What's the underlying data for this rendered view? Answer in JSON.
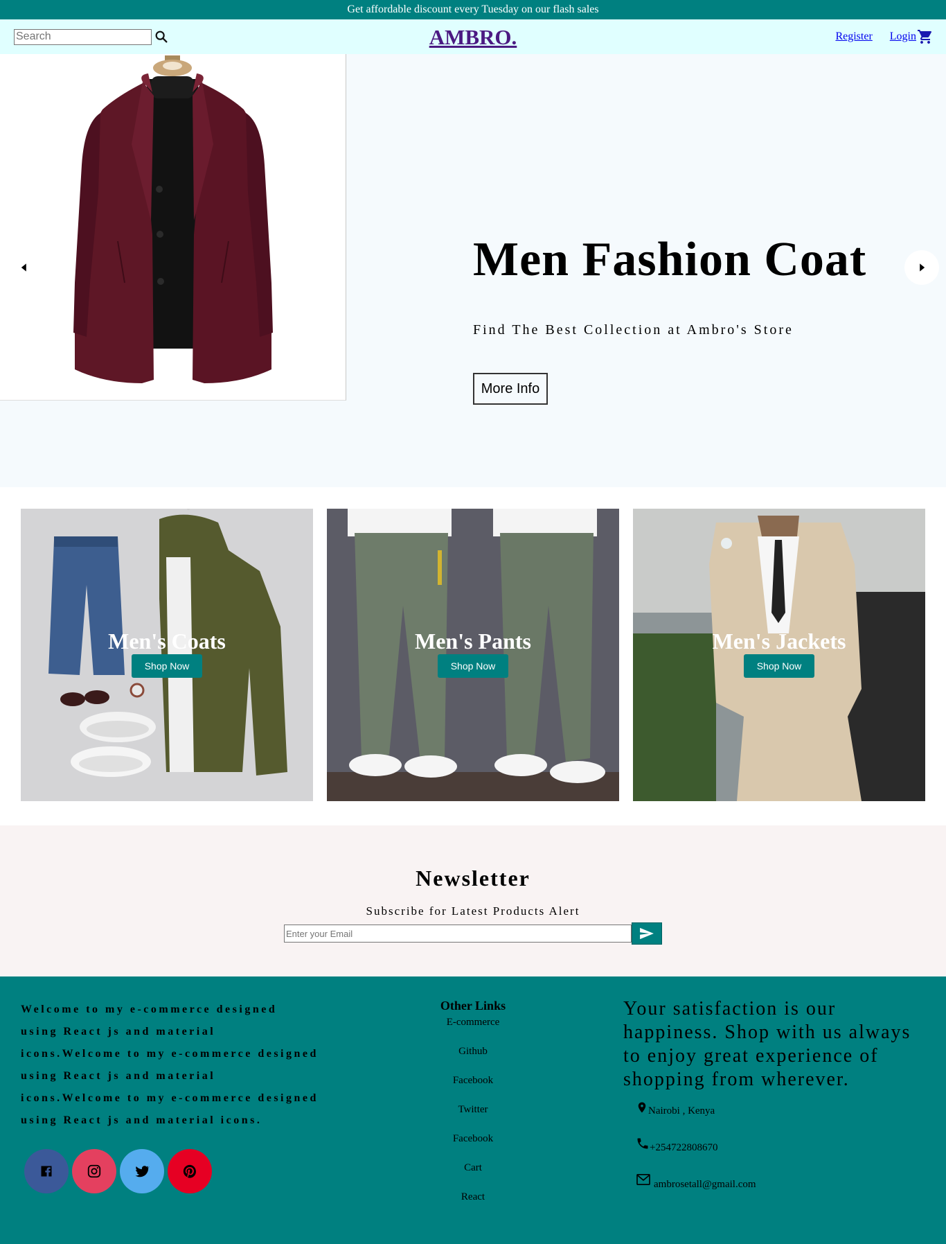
{
  "announcement": "Get affordable discount every Tuesday on our flash sales",
  "navbar": {
    "search_placeholder": "Search",
    "logo": "AMBRO.",
    "register": "Register",
    "login": "Login"
  },
  "slider": {
    "title": "Men Fashion Coat",
    "description": "Find The Best Collection at Ambro's Store",
    "button": "More Info"
  },
  "categories": [
    {
      "title": "Men's Coats",
      "button": "Shop Now"
    },
    {
      "title": "Men's Pants",
      "button": "Shop Now"
    },
    {
      "title": "Men's Jackets",
      "button": "Shop Now"
    }
  ],
  "newsletter": {
    "title": "Newsletter",
    "description": "Subscribe for Latest Products Alert",
    "email_placeholder": "Enter your Email"
  },
  "footer": {
    "about": "Welcome to my e-commerce designed using React js and material icons.Welcome to my e-commerce designed using React js and material icons.Welcome to my e-commerce designed using React js and material icons.",
    "links_title": "Other Links",
    "links": [
      "E-commerce",
      "Github",
      "Facebook",
      "Twitter",
      "Facebook",
      "Cart",
      "React"
    ],
    "tagline": "Your satisfaction is our happiness. Shop with us always to enjoy great experience of shopping from wherever.",
    "location": "Nairobi , Kenya",
    "phone": "+254722808670",
    "email": "ambrosetall@gmail.com"
  },
  "colors": {
    "teal": "#008080",
    "nav_bg": "#e0ffff",
    "logo": "#4b1a82",
    "facebook": "#3b5999",
    "instagram": "#e4405f",
    "twitter": "#55acee",
    "pinterest": "#e60023"
  }
}
